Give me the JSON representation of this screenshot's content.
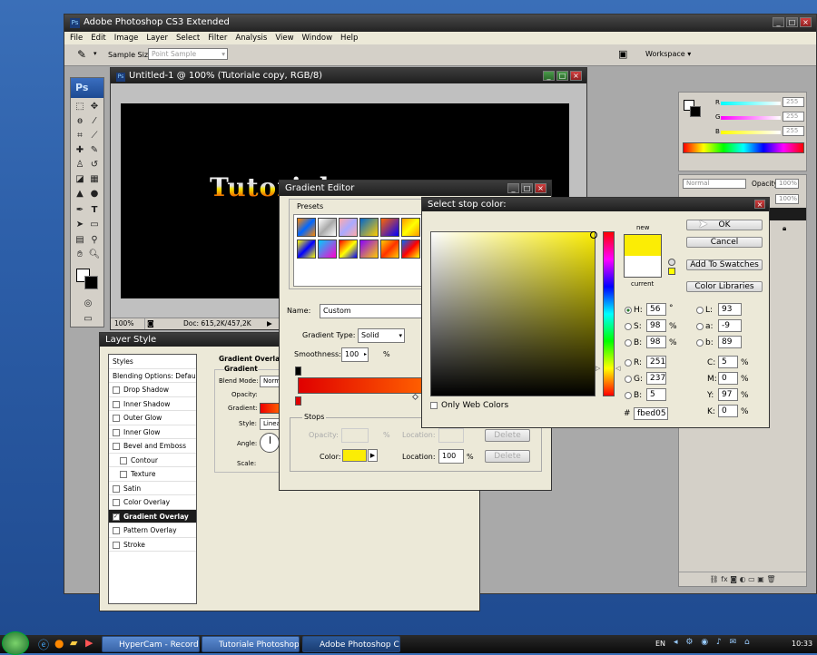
{
  "app": {
    "title": "Adobe Photoshop CS3 Extended",
    "menu": [
      "File",
      "Edit",
      "Image",
      "Layer",
      "Select",
      "Filter",
      "Analysis",
      "View",
      "Window",
      "Help"
    ],
    "options_bar": {
      "sample_size_label": "Sample Size:",
      "sample_size_value": "Point Sample",
      "workspace_label": "Workspace ▾"
    },
    "toolbox_logo": "Ps"
  },
  "document": {
    "title": "Untitled-1 @ 100% (Tutoriale copy, RGB/8)",
    "zoom": "100%",
    "doc_info": "Doc: 615,2K/457,2K",
    "artwork_text": "Tutoriale"
  },
  "color_panel": {
    "r_label": "R",
    "g_label": "G",
    "b_label": "B",
    "r": "255",
    "g": "255",
    "b": "255"
  },
  "layers_panel": {
    "blend_mode": "Normal",
    "opacity_label": "Opacity:",
    "opacity": "100%",
    "fill": "100%"
  },
  "layer_style": {
    "title": "Layer Style",
    "items": [
      {
        "label": "Styles",
        "check": false,
        "indent": false,
        "active": false,
        "plain": true
      },
      {
        "label": "Blending Options: Default",
        "check": false,
        "indent": false,
        "active": false,
        "plain": true
      },
      {
        "label": "Drop Shadow",
        "check": true,
        "indent": false,
        "active": false
      },
      {
        "label": "Inner Shadow",
        "check": true,
        "indent": false,
        "active": false
      },
      {
        "label": "Outer Glow",
        "check": true,
        "indent": false,
        "active": false
      },
      {
        "label": "Inner Glow",
        "check": true,
        "indent": false,
        "active": false
      },
      {
        "label": "Bevel and Emboss",
        "check": true,
        "indent": false,
        "active": false
      },
      {
        "label": "Contour",
        "check": true,
        "indent": true,
        "active": false
      },
      {
        "label": "Texture",
        "check": true,
        "indent": true,
        "active": false
      },
      {
        "label": "Satin",
        "check": true,
        "indent": false,
        "active": false
      },
      {
        "label": "Color Overlay",
        "check": true,
        "indent": false,
        "active": false
      },
      {
        "label": "Gradient Overlay",
        "check": true,
        "indent": false,
        "active": true
      },
      {
        "label": "Pattern Overlay",
        "check": true,
        "indent": false,
        "active": false
      },
      {
        "label": "Stroke",
        "check": true,
        "indent": false,
        "active": false
      }
    ],
    "section_title": "Gradient Overlay",
    "group_title": "Gradient",
    "blend_mode_label": "Blend Mode:",
    "blend_mode_value": "Norm",
    "opacity_label": "Opacity:",
    "gradient_label": "Gradient:",
    "style_label": "Style:",
    "style_value": "Linea",
    "angle_label": "Angle:",
    "scale_label": "Scale:"
  },
  "gradient_editor": {
    "title": "Gradient Editor",
    "presets_label": "Presets",
    "name_label": "Name:",
    "name_value": "Custom",
    "type_label": "Gradient Type:",
    "type_value": "Solid",
    "smoothness_label": "Smoothness:",
    "smoothness_value": "100",
    "smoothness_unit": "%",
    "stops_label": "Stops",
    "opacity_label": "Opacity:",
    "opacity_unit": "%",
    "location_label": "Location:",
    "color_label": "Color:",
    "color_location_label": "Location:",
    "color_location_value": "100",
    "color_location_unit": "%",
    "delete_label": "Delete",
    "stop_color": "#fbed05"
  },
  "color_picker": {
    "title": "Select stop color:",
    "ok": "OK",
    "cancel": "Cancel",
    "add_to_swatches": "Add To Swatches",
    "color_libraries": "Color Libraries",
    "new_label": "new",
    "current_label": "current",
    "only_web_colors": "Only Web Colors",
    "fields": {
      "H": {
        "label": "H:",
        "value": "56",
        "unit": "°"
      },
      "S": {
        "label": "S:",
        "value": "98",
        "unit": "%"
      },
      "B": {
        "label": "B:",
        "value": "98",
        "unit": "%"
      },
      "R": {
        "label": "R:",
        "value": "251"
      },
      "G": {
        "label": "G:",
        "value": "237"
      },
      "Bl": {
        "label": "B:",
        "value": "5"
      },
      "L": {
        "label": "L:",
        "value": "93"
      },
      "a": {
        "label": "a:",
        "value": "-9"
      },
      "b": {
        "label": "b:",
        "value": "89"
      },
      "C": {
        "label": "C:",
        "value": "5",
        "unit": "%"
      },
      "M": {
        "label": "M:",
        "value": "0",
        "unit": "%"
      },
      "Y": {
        "label": "Y:",
        "value": "97",
        "unit": "%"
      },
      "K": {
        "label": "K:",
        "value": "0",
        "unit": "%"
      }
    },
    "hex_label": "#",
    "hex_value": "fbed05",
    "new_color": "#fbed05",
    "current_color": "#ffffff"
  },
  "taskbar": {
    "buttons": [
      "HyperCam - Recording",
      "Tutoriale Photoshop -...",
      "Adobe Photoshop CS..."
    ],
    "lang": "EN",
    "time": "10:33"
  }
}
